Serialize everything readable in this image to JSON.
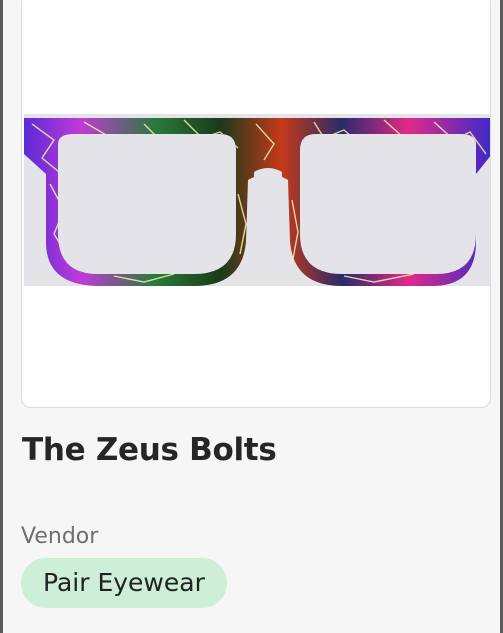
{
  "product": {
    "title": "The Zeus Bolts",
    "image_alt": "Glasses frame with a multicolor lightning bolt pattern"
  },
  "vendor": {
    "label": "Vendor",
    "name": "Pair Eyewear"
  },
  "colors": {
    "vendor_pill_background": "#cdeed7",
    "image_background": "#e4e3e8"
  }
}
